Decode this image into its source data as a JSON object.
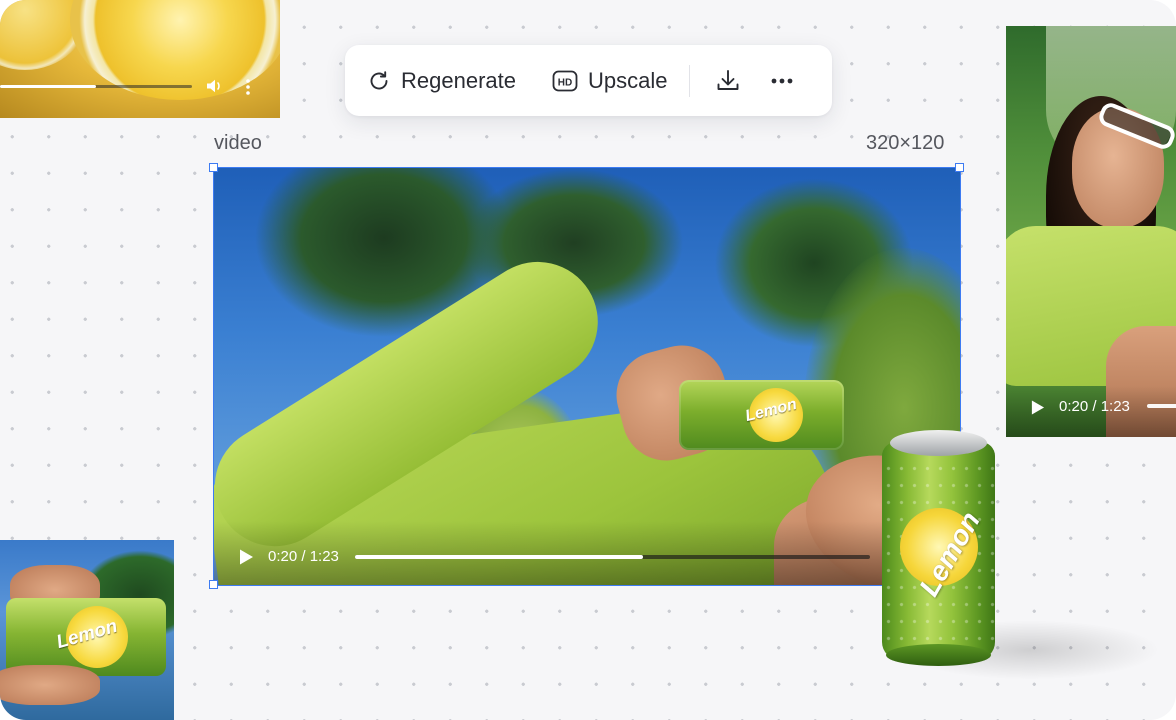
{
  "toolbar": {
    "regenerate_label": "Regenerate",
    "regenerate_icon": "refresh-icon",
    "upscale_label": "Upscale",
    "upscale_icon_text": "HD",
    "download_icon": "download-icon",
    "more_icon": "more-horizontal-icon"
  },
  "frame": {
    "type_label": "video",
    "dimensions_label": "320×120",
    "selection_color": "#3d7bf2"
  },
  "main_video": {
    "time": "0:20 / 1:23",
    "progress": 0.56,
    "can_brand": "Lemon"
  },
  "thumbnail_top_left": {
    "progress": 0.5,
    "volume_icon": "volume-icon",
    "more_icon": "more-vertical-icon"
  },
  "thumbnail_right": {
    "time": "0:20 / 1:23"
  },
  "thumbnail_bottom_left": {
    "can_brand": "Lemon"
  },
  "product_can": {
    "brand": "Lemon"
  },
  "colors": {
    "canvas_background": "#f6f6f8",
    "dot_grid": "#c9cbd1",
    "accent": "#3d7bf2"
  }
}
